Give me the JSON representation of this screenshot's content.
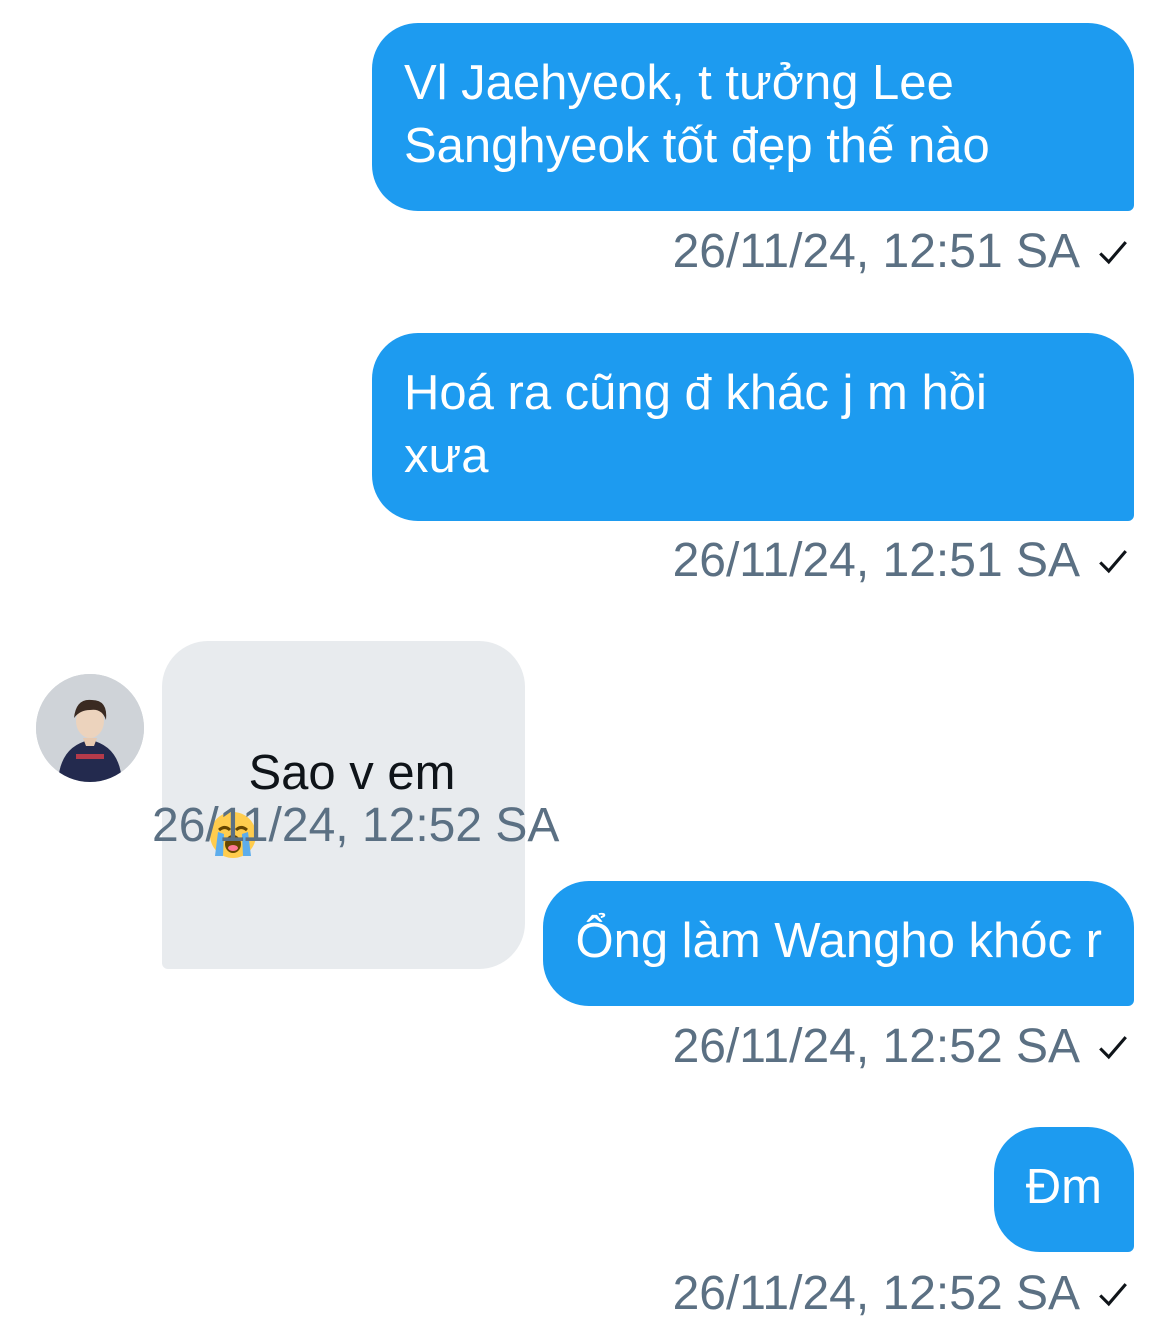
{
  "messages": [
    {
      "direction": "sent",
      "text": "Vl Jaehyeok, t tưởng Lee\nSanghyeok tốt đẹp thế nào",
      "timestamp": "26/11/24, 12:51 SA",
      "status": "check-icon"
    },
    {
      "direction": "sent",
      "text": "Hoá ra cũng đ khác j m hồi\nxưa",
      "timestamp": "26/11/24, 12:51 SA",
      "status": "check-icon"
    },
    {
      "direction": "received",
      "text": "Sao v em",
      "emoji": "😭",
      "emoji_name": "loudly-crying-face-emoji",
      "timestamp": "26/11/24, 12:52 SA"
    },
    {
      "direction": "sent",
      "text": "Ổng làm Wangho khóc r",
      "timestamp": "26/11/24, 12:52 SA",
      "status": "check-icon"
    },
    {
      "direction": "sent",
      "text": "Đm",
      "timestamp": "26/11/24, 12:52 SA",
      "status": "check-icon"
    }
  ],
  "colors": {
    "sent_bubble": "#1d9bf0",
    "received_bubble": "#e8ebee",
    "timestamp": "#5b7083"
  }
}
